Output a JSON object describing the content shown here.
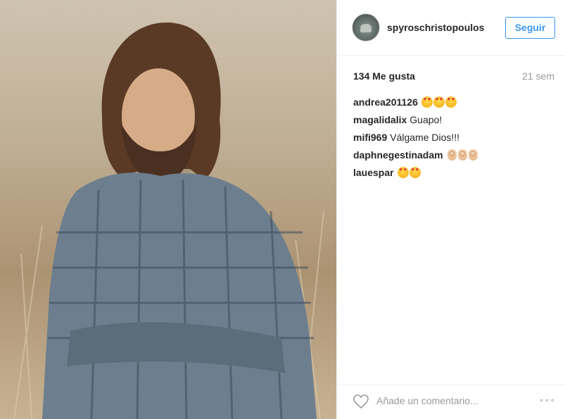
{
  "post": {
    "username": "spyroschristopoulos",
    "follow_label": "Seguir",
    "likes": "134 Me gusta",
    "time": "21 sem",
    "comment_placeholder": "Añade un comentario...",
    "more_label": "∘∘∘",
    "comments": [
      {
        "user": "andrea201126",
        "text": "",
        "emoji": [
          "heart-eyes",
          "heart-eyes",
          "heart-eyes"
        ]
      },
      {
        "user": "magalidalix",
        "text": "Guapo!",
        "emoji": []
      },
      {
        "user": "mifi969",
        "text": "Válgame Dios!!!",
        "emoji": []
      },
      {
        "user": "daphnegestinadam",
        "text": "",
        "emoji": [
          "ok-hand",
          "ok-hand",
          "ok-hand"
        ]
      },
      {
        "user": "lauespar",
        "text": "",
        "emoji": [
          "heart-eyes",
          "heart-eyes"
        ]
      }
    ]
  },
  "icons": {
    "like": "heart-outline-icon",
    "more": "more-options-icon"
  },
  "colors": {
    "accent": "#3897f0",
    "muted": "#999999",
    "text": "#262626",
    "divider": "#efefef"
  }
}
